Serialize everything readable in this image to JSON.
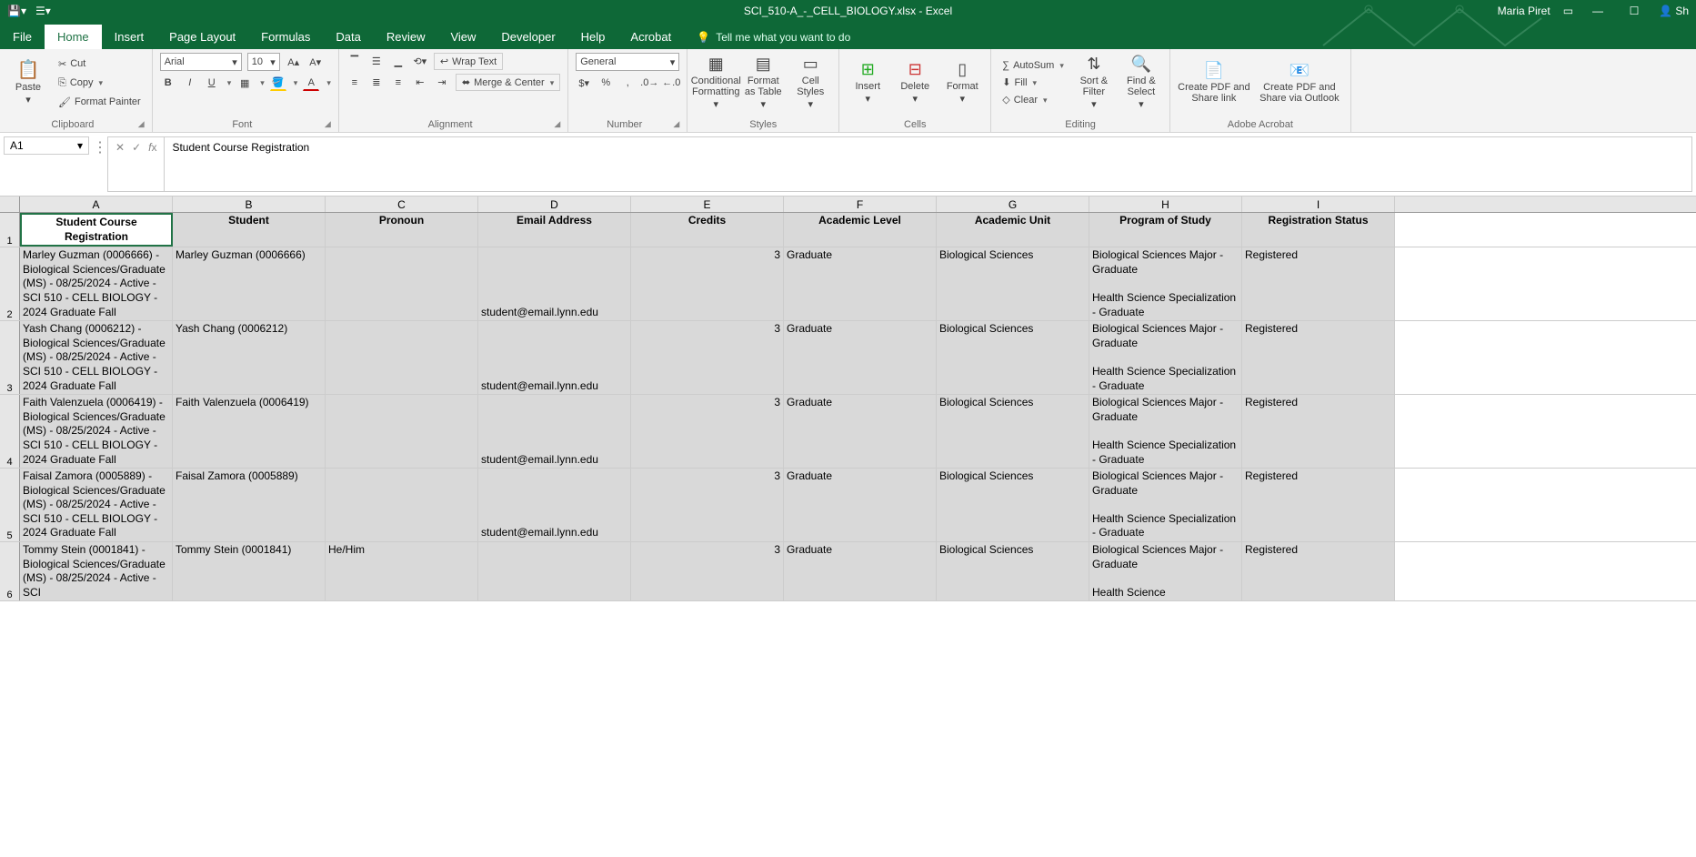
{
  "titlebar": {
    "filename": "SCI_510-A_-_CELL_BIOLOGY.xlsx  -  Excel",
    "username": "Maria Piret",
    "share": "Sh"
  },
  "ribbon_tabs": [
    "File",
    "Home",
    "Insert",
    "Page Layout",
    "Formulas",
    "Data",
    "Review",
    "View",
    "Developer",
    "Help",
    "Acrobat"
  ],
  "tellme": "Tell me what you want to do",
  "clipboard": {
    "paste": "Paste",
    "cut": "Cut",
    "copy": "Copy",
    "painter": "Format Painter",
    "label": "Clipboard"
  },
  "font": {
    "name": "Arial",
    "size": "10",
    "label": "Font",
    "bold": "B",
    "italic": "I",
    "underline": "U"
  },
  "alignment": {
    "wrap": "Wrap Text",
    "merge": "Merge & Center",
    "label": "Alignment"
  },
  "number": {
    "format": "General",
    "label": "Number"
  },
  "styles": {
    "cond": "Conditional Formatting",
    "table": "Format as Table",
    "cell": "Cell Styles",
    "label": "Styles"
  },
  "cells": {
    "insert": "Insert",
    "delete": "Delete",
    "format": "Format",
    "label": "Cells"
  },
  "editing": {
    "autosum": "AutoSum",
    "fill": "Fill",
    "clear": "Clear",
    "sort": "Sort & Filter",
    "find": "Find & Select",
    "label": "Editing"
  },
  "acrobat": {
    "pdf": "Create PDF and Share link",
    "outlook": "Create PDF and Share via Outlook",
    "label": "Adobe Acrobat"
  },
  "namebox": "A1",
  "formula": "Student Course Registration",
  "columns": [
    "A",
    "B",
    "C",
    "D",
    "E",
    "F",
    "G",
    "H",
    "I"
  ],
  "headers": {
    "A": "Student Course Registration",
    "B": "Student",
    "C": "Pronoun",
    "D": "Email Address",
    "E": "Credits",
    "F": "Academic Level",
    "G": "Academic Unit",
    "H": "Program of Study",
    "I": "Registration Status"
  },
  "rows": [
    {
      "n": "2",
      "A": "Marley Guzman (0006666) - Biological Sciences/Graduate (MS) - 08/25/2024 - Active - SCI 510 - CELL BIOLOGY - 2024 Graduate Fall",
      "B": "Marley Guzman (0006666)",
      "C": "",
      "D": "student@email.lynn.edu",
      "E": "3",
      "F": "Graduate",
      "G": "Biological Sciences",
      "H": "Biological Sciences Major - Graduate\n\nHealth Science Specialization - Graduate",
      "I": "Registered"
    },
    {
      "n": "3",
      "A": "Yash Chang (0006212) - Biological Sciences/Graduate (MS) - 08/25/2024 - Active - SCI 510 - CELL BIOLOGY - 2024 Graduate Fall",
      "B": "Yash Chang (0006212)",
      "C": "",
      "D": "student@email.lynn.edu",
      "E": "3",
      "F": "Graduate",
      "G": "Biological Sciences",
      "H": "Biological Sciences Major - Graduate\n\nHealth Science Specialization - Graduate",
      "I": "Registered"
    },
    {
      "n": "4",
      "A": "Faith Valenzuela (0006419) - Biological Sciences/Graduate (MS) - 08/25/2024 - Active - SCI 510 - CELL BIOLOGY - 2024 Graduate Fall",
      "B": "Faith Valenzuela (0006419)",
      "C": "",
      "D": "student@email.lynn.edu",
      "E": "3",
      "F": "Graduate",
      "G": "Biological Sciences",
      "H": "Biological Sciences Major - Graduate\n\nHealth Science Specialization - Graduate",
      "I": "Registered"
    },
    {
      "n": "5",
      "A": "Faisal Zamora (0005889) - Biological Sciences/Graduate (MS) - 08/25/2024 - Active - SCI 510 - CELL BIOLOGY - 2024 Graduate Fall",
      "B": "Faisal Zamora (0005889)",
      "C": "",
      "D": "student@email.lynn.edu",
      "E": "3",
      "F": "Graduate",
      "G": "Biological Sciences",
      "H": "Biological Sciences Major - Graduate\n\nHealth Science Specialization - Graduate",
      "I": "Registered"
    },
    {
      "n": "6",
      "A": "Tommy Stein (0001841) - Biological Sciences/Graduate (MS) - 08/25/2024 - Active - SCI",
      "B": "Tommy Stein (0001841)",
      "C": "He/Him",
      "D": "",
      "E": "3",
      "F": "Graduate",
      "G": "Biological Sciences",
      "H": "Biological Sciences Major - Graduate\n\nHealth Science",
      "I": "Registered"
    }
  ]
}
